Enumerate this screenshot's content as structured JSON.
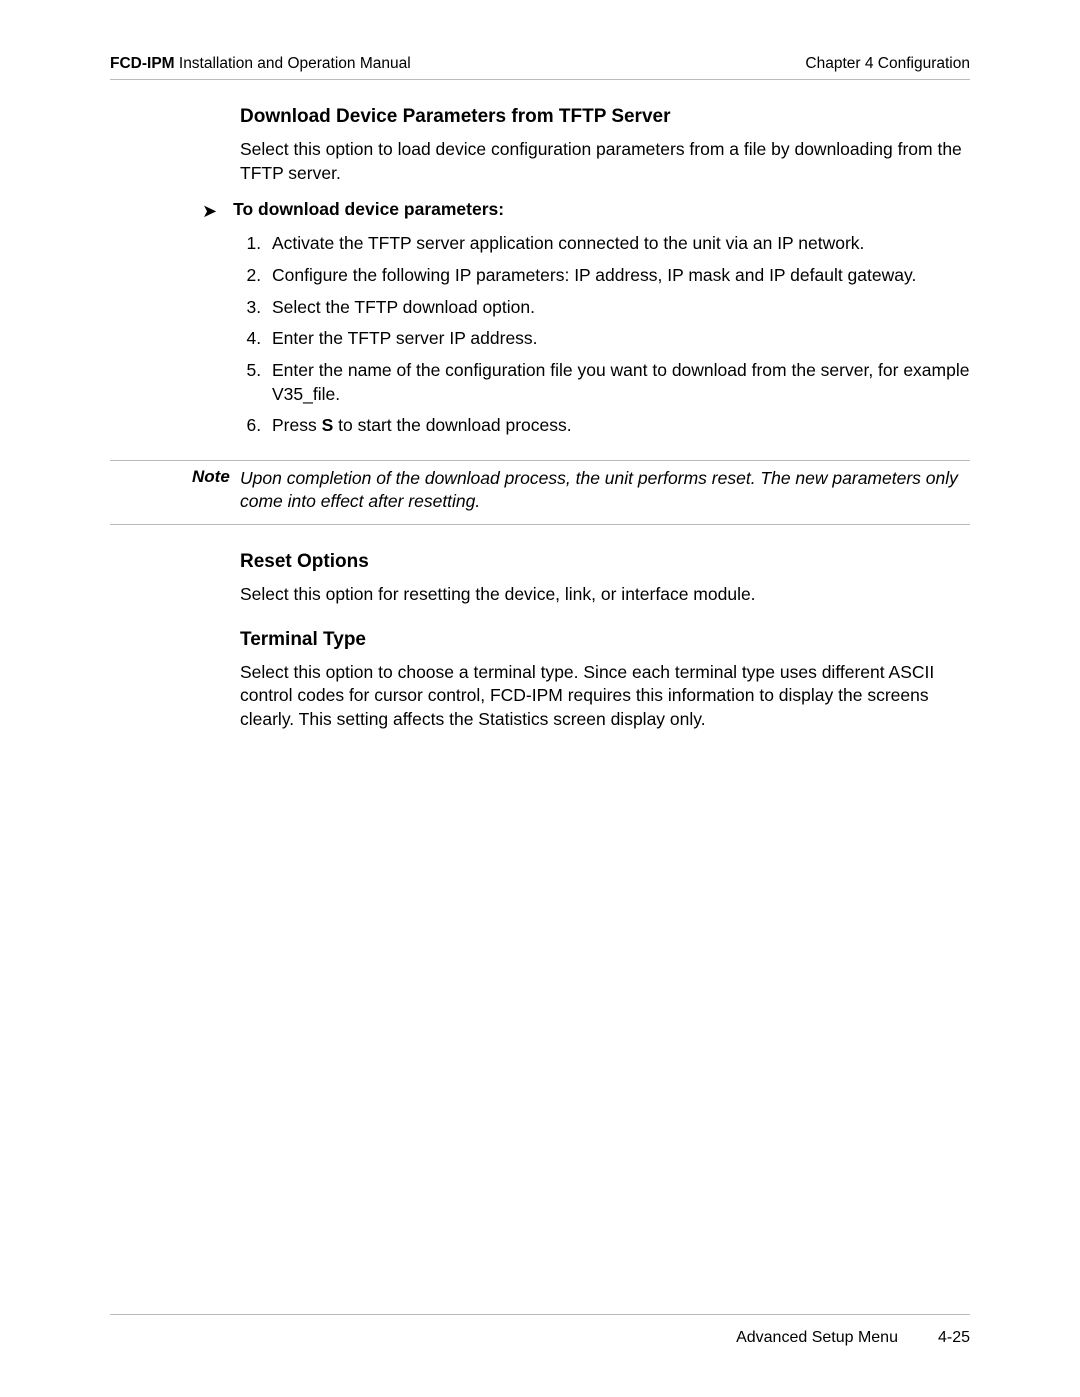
{
  "header": {
    "product": "FCD-IPM",
    "manual": " Installation and Operation Manual",
    "chapter": "Chapter 4  Configuration"
  },
  "section1": {
    "title": "Download Device Parameters from TFTP Server",
    "intro": "Select this option to load device configuration parameters from a file by downloading from the TFTP server.",
    "instruction": "To download device parameters:",
    "steps": {
      "s1": "Activate the TFTP server application connected to the unit via an IP network.",
      "s2": "Configure the following IP parameters: IP address, IP mask and IP default gateway.",
      "s3": "Select the TFTP download option.",
      "s4": "Enter the TFTP server IP address.",
      "s5": "Enter the name of the configuration file you want to download from the server, for example V35_file.",
      "s6a": "Press ",
      "s6b": "S",
      "s6c": " to start the download process."
    }
  },
  "note": {
    "label": "Note",
    "text": "Upon completion of the download process, the unit performs reset. The new parameters only come into effect after resetting."
  },
  "section2": {
    "title": "Reset Options",
    "text": "Select this option for resetting the device, link, or interface module."
  },
  "section3": {
    "title": "Terminal Type",
    "text": "Select this option to choose a terminal type. Since each terminal type uses different ASCII control codes for cursor control, FCD-IPM requires this information to display the screens clearly. This setting affects the Statistics screen display only."
  },
  "footer": {
    "menu": "Advanced Setup Menu",
    "page": "4-25"
  }
}
